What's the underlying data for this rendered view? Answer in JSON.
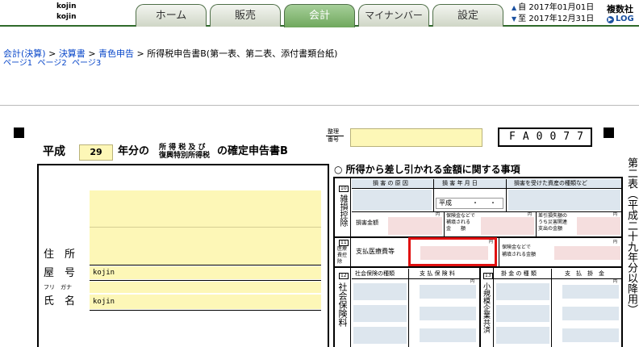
{
  "header": {
    "user_line1": "kojin",
    "user_line2": "kojin",
    "tabs": [
      {
        "label": "ホーム"
      },
      {
        "label": "販売"
      },
      {
        "label": "会計",
        "active": true
      },
      {
        "label": "マイナンバー"
      },
      {
        "label": "設定"
      }
    ],
    "period_from_label": "自",
    "period_from": "2017年01月01日",
    "period_to_label": "至",
    "period_to": "2017年12月31日",
    "company": "複数社",
    "logout": "LOG"
  },
  "breadcrumb": {
    "item1": "会計(決算)",
    "item2": "決算書",
    "item3": "青色申告",
    "current": "所得税申告書B(第一表、第二表、添付書類台紙)",
    "sep": ">"
  },
  "pages": [
    "ページ1",
    "ページ2",
    "ページ3"
  ],
  "form": {
    "era": "平成",
    "year": "29",
    "title_suffix": "年分の",
    "tax_small_1": "所 得 税 及 び",
    "tax_small_2": "復興特別所得税",
    "title_main": "の確定申告書B",
    "seiri_1": "整理",
    "seiri_2": "番号",
    "form_code": "FA0077",
    "address_label": "住　所",
    "shop_label": "屋　号",
    "shop_value": "kojin",
    "furigana_label": "フリ　ガナ",
    "name_label": "氏　名",
    "name_value": "kojin",
    "section_title": "○ 所得から差し引かれる金額に関する事項",
    "side_text": "第二表（平成二十九年分以降用）",
    "s10_num": "10",
    "s10_label": "雑損控除",
    "s10_h1": "損 害 の 原 因",
    "s10_h2": "損 害 年 月 日",
    "s10_h3": "損害を受けた資産の種類など",
    "s10_era": "平成",
    "s10_dot": "・",
    "s10_amount": "損害金額",
    "s10_ins_1": "保険金などで",
    "s10_ins_2": "補填される",
    "s10_ins_3": "金　　額",
    "s10_disaster_1": "差引損失額の",
    "s10_disaster_2": "うち災害関連",
    "s10_disaster_3": "支出の金額",
    "yen": "円",
    "s11_num": "11",
    "s11_label_1": "医療",
    "s11_label_2": "費控",
    "s11_label_3": "除",
    "s11_paid": "支払医療費等",
    "s11_ins_1": "保険金などで",
    "s11_ins_2": "補填される金額",
    "s12_num": "12",
    "s12_label": "社会保険料",
    "s12_h1": "社会保険の種類",
    "s12_h2": "支 払 保 険 料",
    "s13_num": "13",
    "s13_label": "小規模企業共済",
    "s13_h1": "掛 金 の 種 類",
    "s13_h2": "支　払　掛　金"
  }
}
